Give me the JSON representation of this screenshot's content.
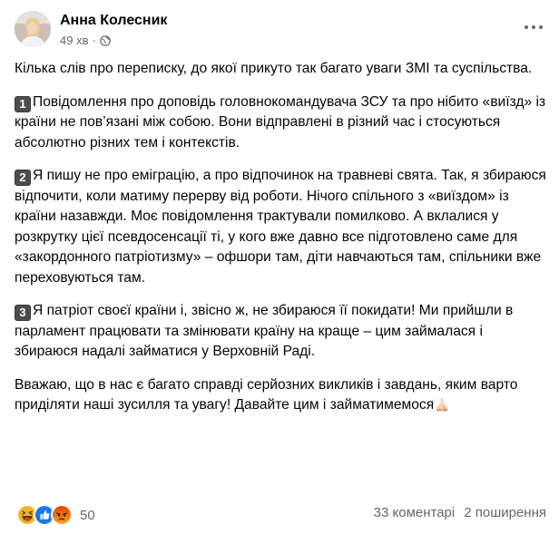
{
  "post": {
    "author": "Анна Колесник",
    "time": "49 хв",
    "dot": "·",
    "privacy_icon": "globe-icon",
    "paragraphs": {
      "intro": "Кілька слів про переписку, до якої прикуто так багато уваги ЗМІ та суспільства.",
      "p1_num": "1",
      "p1": "Повідомлення про доповідь головнокомандувача ЗСУ та про нібито «виїзд» із країни не пов’язані між собою. Вони відправлені в різний час і стосуються абсолютно різних тем і контекстів.",
      "p2_num": "2",
      "p2": "Я пишу не про еміграцію, а про відпочинок на травневі свята. Так, я збираюся відпочити, коли матиму перерву від роботи. Нічого спільного з «виїздом» із країни назавжди. Моє повідомлення трактували помилково. А вклалися у розкрутку цієї псевдосенсації ті, у кого вже давно все підготовлено саме для «закордонного патріотизму» – офшори там, діти навчаються там, спільники вже переховуються там.",
      "p3_num": "3",
      "p3": "Я патріот своєї країни і, звісно ж, не збираюся її покидати! Ми прийшли в парламент працювати та змінювати країну на краще – цим займалася і збираюся надалі займатися у Верховній Раді.",
      "outro": "Вважаю, що в нас є багато справді серйозних викликів і завдань, яким варто приділяти наші зусилля та увагу! Давайте цим і займатимемося"
    },
    "reaction_count": "50",
    "comments": "33 коментарі",
    "shares": "2 поширення",
    "colors": {
      "haha": "#f7b125",
      "like": "#1877f2",
      "angry": "#e9710f"
    }
  }
}
